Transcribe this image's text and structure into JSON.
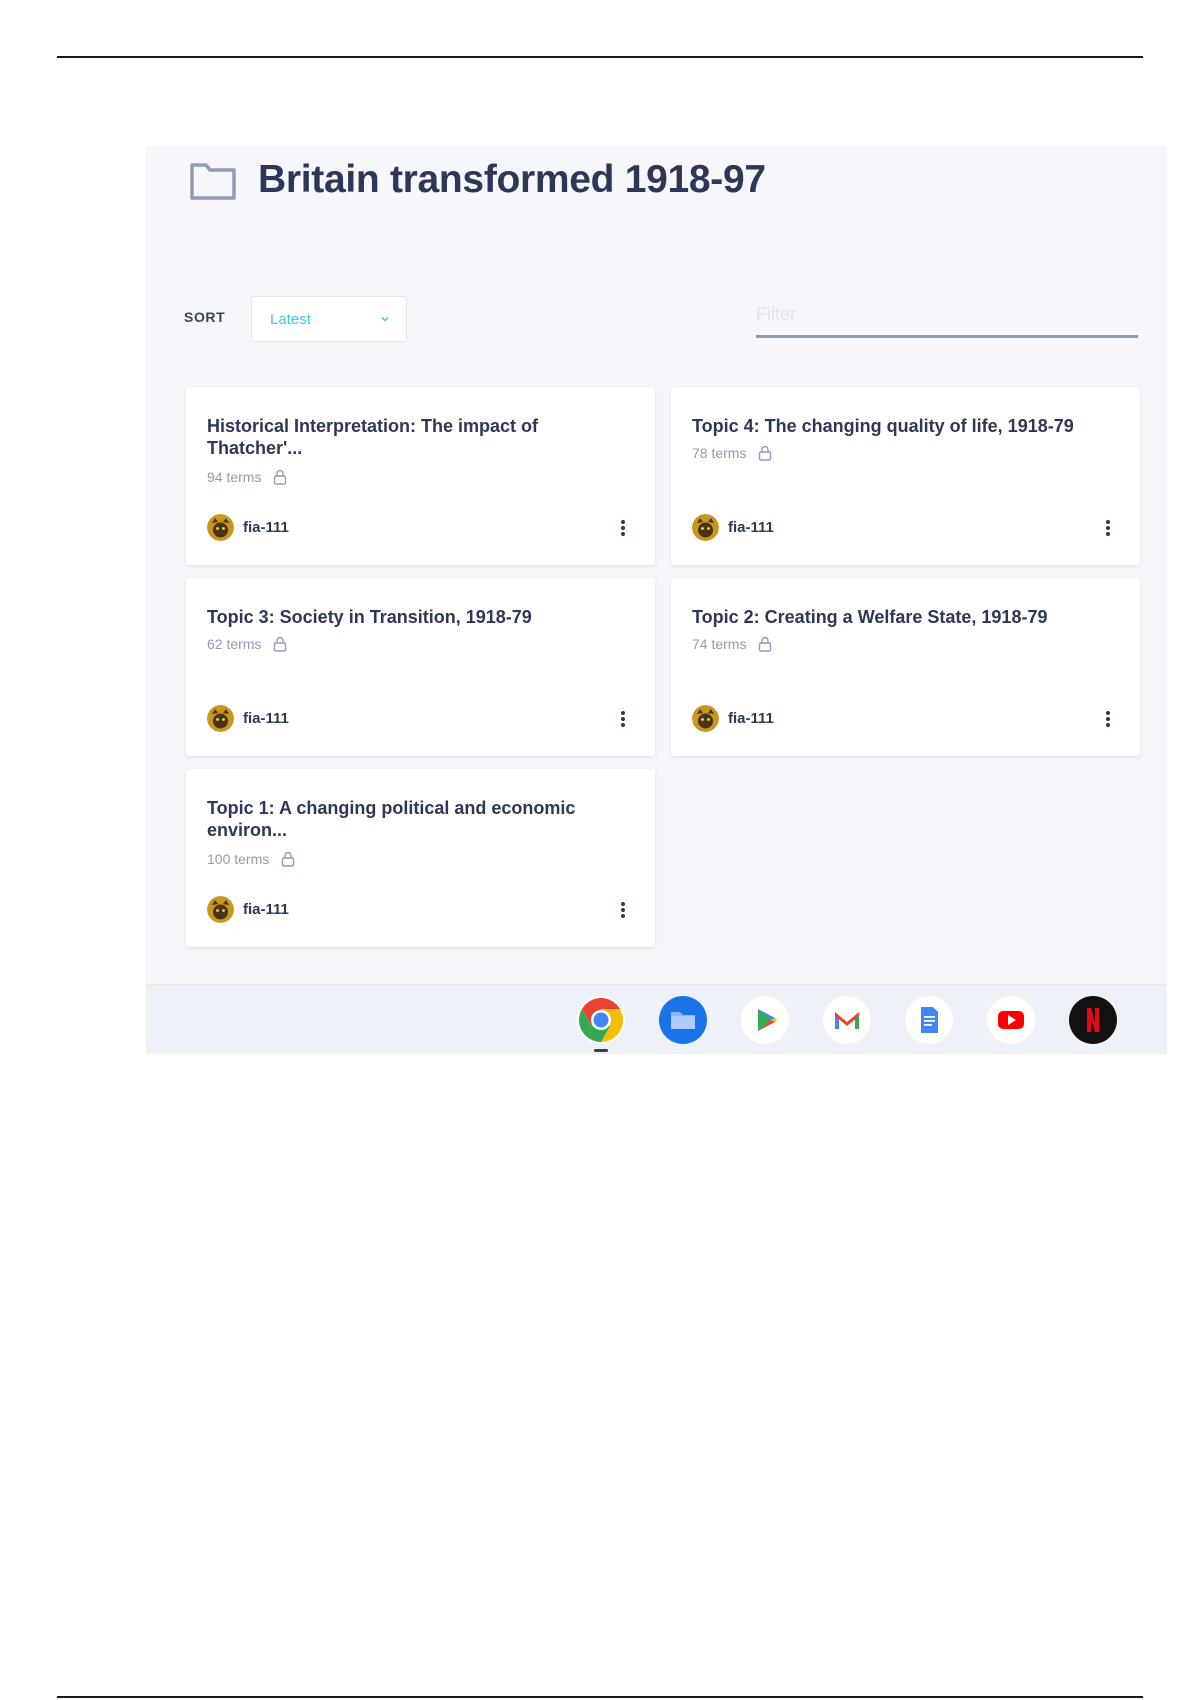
{
  "page": {
    "title": "Britain transformed 1918-97"
  },
  "toolbar": {
    "sort_label": "SORT",
    "sort_value": "Latest",
    "filter_placeholder": "Filter"
  },
  "sets": [
    {
      "title": "Historical Interpretation: The impact of Thatcher'...",
      "terms": "94 terms",
      "user": "fia-111"
    },
    {
      "title": "Topic 4: The changing quality of life, 1918-79",
      "terms": "78 terms",
      "user": "fia-111"
    },
    {
      "title": "Topic 3: Society in Transition, 1918-79",
      "terms": "62 terms",
      "user": "fia-111"
    },
    {
      "title": "Topic 2: Creating a Welfare State, 1918-79",
      "terms": "74 terms",
      "user": "fia-111"
    },
    {
      "title": "Topic 1: A changing political and economic environ...",
      "terms": "100 terms",
      "user": "fia-111"
    }
  ],
  "shelf": {
    "apps": [
      "chrome-icon",
      "files-icon",
      "play-store-icon",
      "gmail-icon",
      "docs-icon",
      "youtube-icon",
      "netflix-icon"
    ],
    "active_app": "chrome-icon"
  },
  "colors": {
    "accent": "#3ccfcf",
    "text": "#2e3856",
    "muted": "#939bb4",
    "background": "#f6f7fb"
  }
}
